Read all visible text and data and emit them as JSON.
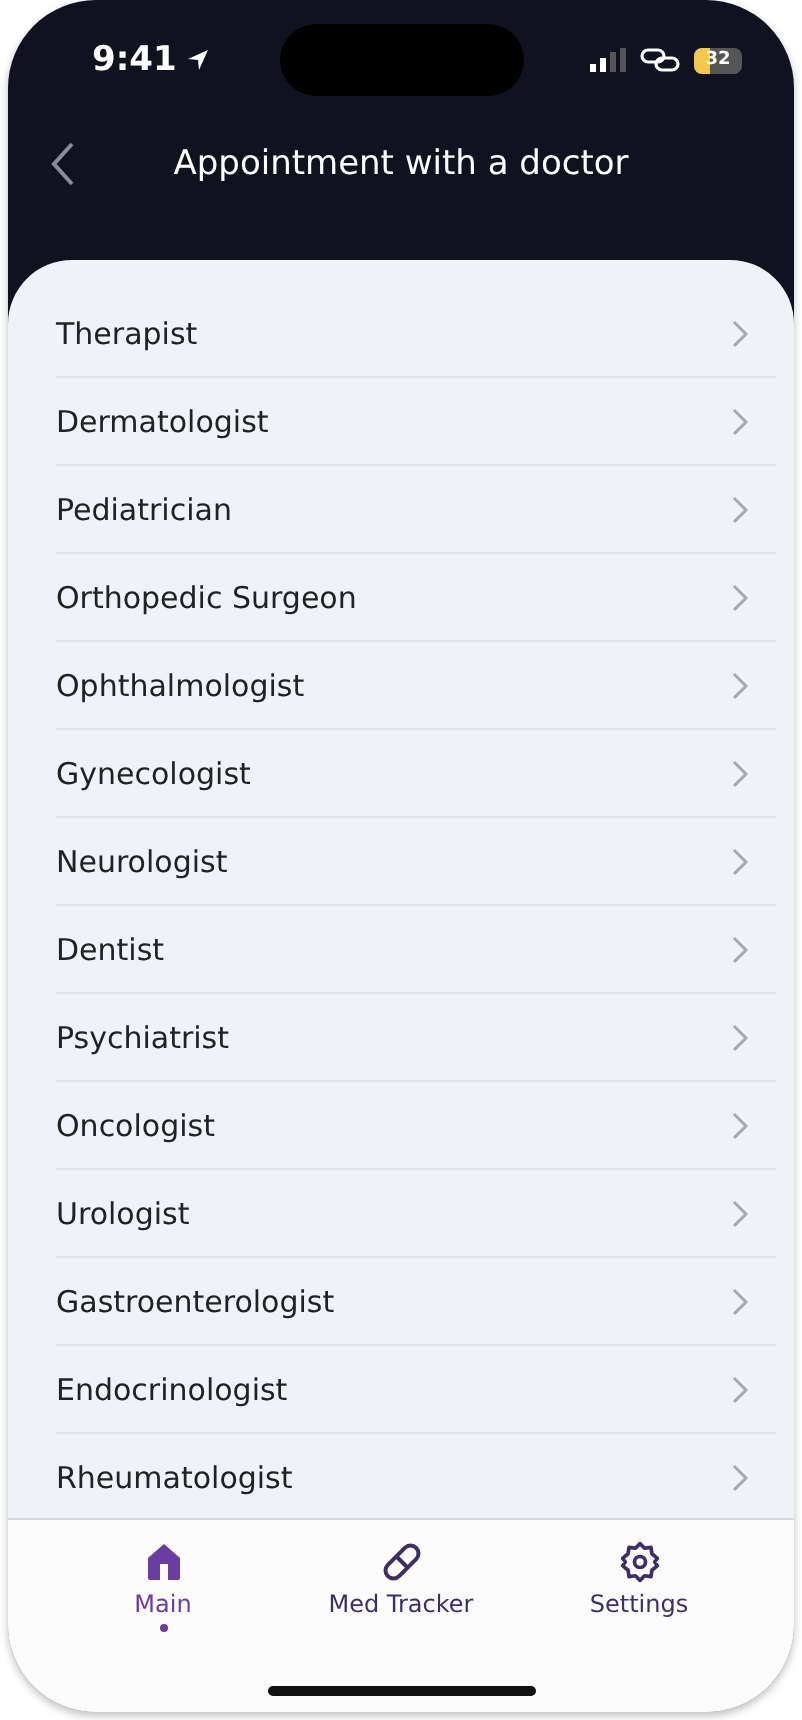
{
  "status_bar": {
    "time": "9:41",
    "battery": "32"
  },
  "header": {
    "title": "Appointment with a doctor"
  },
  "specialists": [
    {
      "label": "Therapist"
    },
    {
      "label": "Dermatologist"
    },
    {
      "label": "Pediatrician"
    },
    {
      "label": "Orthopedic Surgeon"
    },
    {
      "label": "Ophthalmologist"
    },
    {
      "label": "Gynecologist"
    },
    {
      "label": "Neurologist"
    },
    {
      "label": "Dentist"
    },
    {
      "label": "Psychiatrist"
    },
    {
      "label": "Oncologist"
    },
    {
      "label": "Urologist"
    },
    {
      "label": "Gastroenterologist"
    },
    {
      "label": "Endocrinologist"
    },
    {
      "label": "Rheumatologist"
    }
  ],
  "tab_bar": [
    {
      "kind": "home",
      "label": "Main",
      "selected": true
    },
    {
      "kind": "pill",
      "label": "Med Tracker",
      "selected": false
    },
    {
      "kind": "gear",
      "label": "Settings",
      "selected": false
    }
  ]
}
